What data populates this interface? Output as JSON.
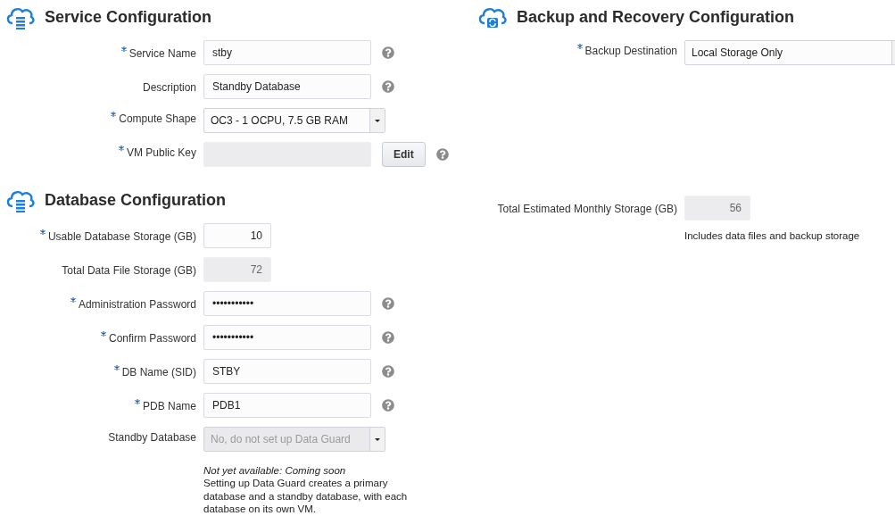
{
  "columns": [
    {
      "sections": [
        {
          "kind": "database",
          "title": "Service Configuration",
          "fields": [
            {
              "kind": "text",
              "label": "Service Name",
              "required": true,
              "value": "stby",
              "help": true
            },
            {
              "kind": "text",
              "label": "Description",
              "required": false,
              "value": "Standby Database",
              "help": true
            },
            {
              "kind": "select",
              "label": "Compute Shape",
              "required": true,
              "value": "OC3 - 1 OCPU, 7.5 GB RAM",
              "disabled": false
            },
            {
              "kind": "key",
              "label": "VM Public Key",
              "required": true,
              "button": "Edit",
              "help": true
            }
          ]
        },
        {
          "kind": "database",
          "title": "Database Configuration",
          "fields": [
            {
              "kind": "number",
              "label": "Usable Database Storage (GB)",
              "required": true,
              "value": "10"
            },
            {
              "kind": "readonly",
              "label": "Total Data File Storage (GB)",
              "required": false,
              "value": "72"
            },
            {
              "kind": "text",
              "label": "Administration Password",
              "required": true,
              "value": "•••••••••••",
              "help": true
            },
            {
              "kind": "text",
              "label": "Confirm Password",
              "required": true,
              "value": "•••••••••••",
              "help": true
            },
            {
              "kind": "text",
              "label": "DB Name (SID)",
              "required": true,
              "value": "STBY",
              "help": true
            },
            {
              "kind": "text",
              "label": "PDB Name",
              "required": true,
              "value": "PDB1",
              "help": true
            },
            {
              "kind": "select",
              "label": "Standby Database",
              "required": false,
              "value": "No, do not set up Data Guard",
              "disabled": true,
              "note_title": "Not yet available: Coming soon",
              "note": "Setting up Data Guard creates a primary database and a standby database, with each database on its own VM."
            }
          ]
        }
      ]
    },
    {
      "sections": [
        {
          "kind": "backup",
          "title": "Backup and Recovery Configuration",
          "fields": [
            {
              "kind": "select",
              "label": "Backup Destination",
              "required": true,
              "value": "Local Storage Only",
              "disabled": false
            },
            {
              "kind": "estimate",
              "label": "Total Estimated Monthly Storage (GB)",
              "required": false,
              "value": "56",
              "note": "Includes data files and backup storage"
            }
          ]
        }
      ]
    }
  ]
}
